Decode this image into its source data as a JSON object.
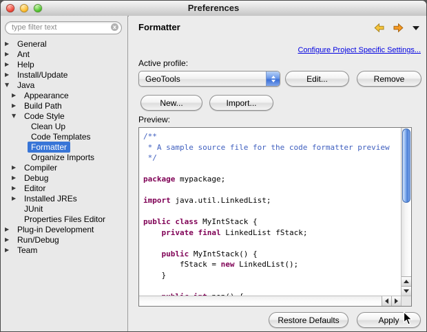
{
  "window": {
    "title": "Preferences"
  },
  "colors": {
    "selection": "#3875d7",
    "keyword": "#7f0055",
    "comment": "#3f5fbf",
    "link": "#0000e0",
    "back_arrow": "#f5c33b",
    "forward_arrow": "#f59a23"
  },
  "icons": {
    "back": "back-arrow",
    "forward": "forward-arrow",
    "view_menu": "view-menu-triangle",
    "clear_filter": "clear-circle-x",
    "close": "close-traffic-light",
    "minimize": "minimize-traffic-light",
    "zoom": "zoom-traffic-light"
  },
  "sidebar": {
    "filter_placeholder": "type filter text",
    "clear_glyph": "x",
    "tree": [
      {
        "label": "General",
        "arrow": "right",
        "level": 0,
        "selected": false
      },
      {
        "label": "Ant",
        "arrow": "right",
        "level": 0,
        "selected": false
      },
      {
        "label": "Help",
        "arrow": "right",
        "level": 0,
        "selected": false
      },
      {
        "label": "Install/Update",
        "arrow": "right",
        "level": 0,
        "selected": false
      },
      {
        "label": "Java",
        "arrow": "down",
        "level": 0,
        "selected": false
      },
      {
        "label": "Appearance",
        "arrow": "right",
        "level": 1,
        "selected": false
      },
      {
        "label": "Build Path",
        "arrow": "right",
        "level": 1,
        "selected": false
      },
      {
        "label": "Code Style",
        "arrow": "down",
        "level": 1,
        "selected": false
      },
      {
        "label": "Clean Up",
        "arrow": "none",
        "level": 2,
        "selected": false
      },
      {
        "label": "Code Templates",
        "arrow": "none",
        "level": 2,
        "selected": false
      },
      {
        "label": "Formatter",
        "arrow": "none",
        "level": 2,
        "selected": true
      },
      {
        "label": "Organize Imports",
        "arrow": "none",
        "level": 2,
        "selected": false
      },
      {
        "label": "Compiler",
        "arrow": "right",
        "level": 1,
        "selected": false
      },
      {
        "label": "Debug",
        "arrow": "right",
        "level": 1,
        "selected": false
      },
      {
        "label": "Editor",
        "arrow": "right",
        "level": 1,
        "selected": false
      },
      {
        "label": "Installed JREs",
        "arrow": "right",
        "level": 1,
        "selected": false
      },
      {
        "label": "JUnit",
        "arrow": "none",
        "level": 1,
        "selected": false
      },
      {
        "label": "Properties Files Editor",
        "arrow": "none",
        "level": 1,
        "selected": false
      },
      {
        "label": "Plug-in Development",
        "arrow": "right",
        "level": 0,
        "selected": false
      },
      {
        "label": "Run/Debug",
        "arrow": "right",
        "level": 0,
        "selected": false
      },
      {
        "label": "Team",
        "arrow": "right",
        "level": 0,
        "selected": false
      }
    ]
  },
  "header": {
    "title": "Formatter"
  },
  "content": {
    "link_label": "Configure Project Specific Settings...",
    "active_profile_label": "Active profile:",
    "profile_selected": "GeoTools",
    "edit_label": "Edit...",
    "remove_label": "Remove",
    "new_label": "New...",
    "import_label": "Import...",
    "preview_label": "Preview:",
    "code": [
      [
        [
          "c",
          "/**"
        ]
      ],
      [
        [
          "c",
          " * A sample source file for the code formatter preview"
        ]
      ],
      [
        [
          "c",
          " */"
        ]
      ],
      [],
      [
        [
          "k",
          "package"
        ],
        [
          "p",
          " mypackage;"
        ]
      ],
      [],
      [
        [
          "k",
          "import"
        ],
        [
          "p",
          " java.util.LinkedList;"
        ]
      ],
      [],
      [
        [
          "k",
          "public"
        ],
        [
          "p",
          " "
        ],
        [
          "k",
          "class"
        ],
        [
          "p",
          " MyIntStack {"
        ]
      ],
      [
        [
          "p",
          "    "
        ],
        [
          "k",
          "private"
        ],
        [
          "p",
          " "
        ],
        [
          "k",
          "final"
        ],
        [
          "p",
          " LinkedList fStack;"
        ]
      ],
      [],
      [
        [
          "p",
          "    "
        ],
        [
          "k",
          "public"
        ],
        [
          "p",
          " MyIntStack() {"
        ]
      ],
      [
        [
          "p",
          "        fStack = "
        ],
        [
          "k",
          "new"
        ],
        [
          "p",
          " LinkedList();"
        ]
      ],
      [
        [
          "p",
          "    }"
        ]
      ],
      [],
      [
        [
          "p",
          "    "
        ],
        [
          "k",
          "public"
        ],
        [
          "p",
          " "
        ],
        [
          "k",
          "int"
        ],
        [
          "p",
          " pop() {"
        ]
      ]
    ]
  },
  "footer": {
    "restore_label": "Restore Defaults",
    "apply_label": "Apply"
  }
}
